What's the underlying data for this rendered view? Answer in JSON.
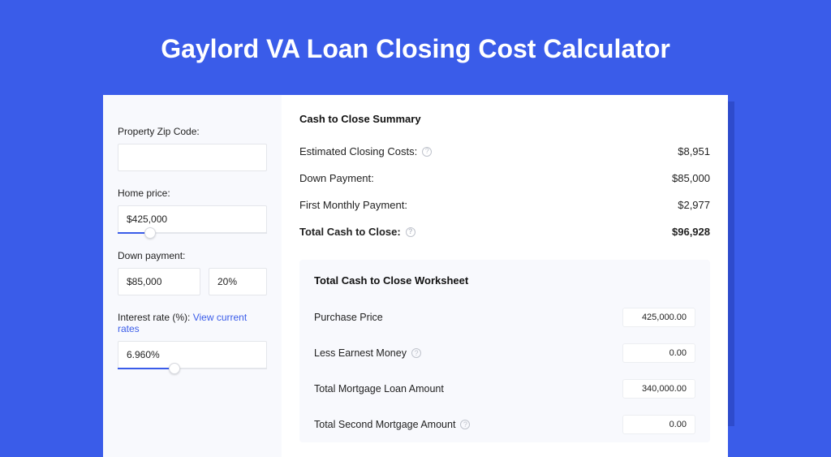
{
  "title": "Gaylord VA Loan Closing Cost Calculator",
  "sidebar": {
    "zip": {
      "label": "Property Zip Code:",
      "value": ""
    },
    "home_price": {
      "label": "Home price:",
      "value": "$425,000",
      "slider_pct": 22
    },
    "down_payment": {
      "label": "Down payment:",
      "value": "$85,000",
      "percent": "20%"
    },
    "interest": {
      "label_prefix": "Interest rate (%): ",
      "link_text": "View current rates",
      "value": "6.960%",
      "slider_pct": 38
    }
  },
  "summary": {
    "heading": "Cash to Close Summary",
    "rows": [
      {
        "label": "Estimated Closing Costs:",
        "help": true,
        "value": "$8,951"
      },
      {
        "label": "Down Payment:",
        "help": false,
        "value": "$85,000"
      },
      {
        "label": "First Monthly Payment:",
        "help": false,
        "value": "$2,977"
      }
    ],
    "total": {
      "label": "Total Cash to Close:",
      "help": true,
      "value": "$96,928"
    }
  },
  "worksheet": {
    "heading": "Total Cash to Close Worksheet",
    "rows": [
      {
        "label": "Purchase Price",
        "help": false,
        "value": "425,000.00"
      },
      {
        "label": "Less Earnest Money",
        "help": true,
        "value": "0.00"
      },
      {
        "label": "Total Mortgage Loan Amount",
        "help": false,
        "value": "340,000.00"
      },
      {
        "label": "Total Second Mortgage Amount",
        "help": true,
        "value": "0.00"
      }
    ]
  }
}
